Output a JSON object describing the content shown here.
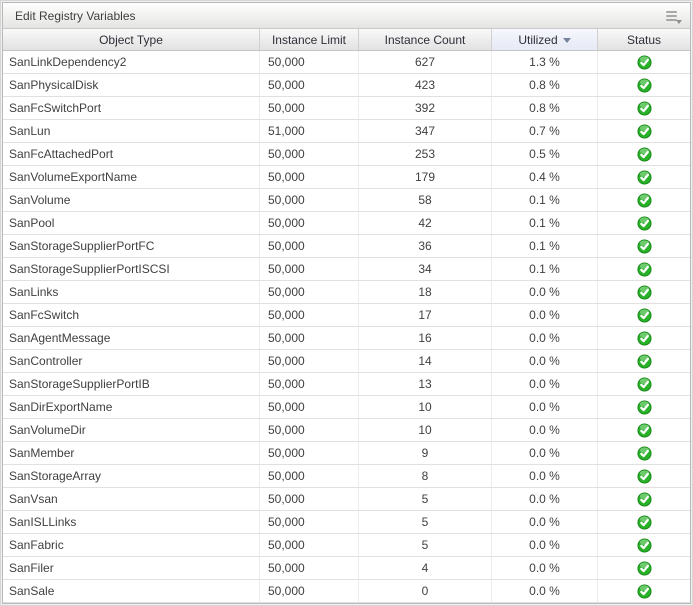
{
  "panel": {
    "title": "Edit Registry Variables",
    "tool_icon": "grid-menu-icon"
  },
  "table": {
    "columns": [
      {
        "id": "object_type",
        "label": "Object Type"
      },
      {
        "id": "instance_limit",
        "label": "Instance Limit"
      },
      {
        "id": "instance_count",
        "label": "Instance Count"
      },
      {
        "id": "utilized",
        "label": "Utilized"
      },
      {
        "id": "status",
        "label": "Status"
      }
    ],
    "sort": {
      "column": "Utilized",
      "direction": "desc"
    },
    "rows": [
      {
        "object_type": "SanLinkDependency2",
        "instance_limit": "50,000",
        "instance_count": "627",
        "utilized": "1.3 %",
        "status": "ok"
      },
      {
        "object_type": "SanPhysicalDisk",
        "instance_limit": "50,000",
        "instance_count": "423",
        "utilized": "0.8 %",
        "status": "ok"
      },
      {
        "object_type": "SanFcSwitchPort",
        "instance_limit": "50,000",
        "instance_count": "392",
        "utilized": "0.8 %",
        "status": "ok"
      },
      {
        "object_type": "SanLun",
        "instance_limit": "51,000",
        "instance_count": "347",
        "utilized": "0.7 %",
        "status": "ok"
      },
      {
        "object_type": "SanFcAttachedPort",
        "instance_limit": "50,000",
        "instance_count": "253",
        "utilized": "0.5 %",
        "status": "ok"
      },
      {
        "object_type": "SanVolumeExportName",
        "instance_limit": "50,000",
        "instance_count": "179",
        "utilized": "0.4 %",
        "status": "ok"
      },
      {
        "object_type": "SanVolume",
        "instance_limit": "50,000",
        "instance_count": "58",
        "utilized": "0.1 %",
        "status": "ok"
      },
      {
        "object_type": "SanPool",
        "instance_limit": "50,000",
        "instance_count": "42",
        "utilized": "0.1 %",
        "status": "ok"
      },
      {
        "object_type": "SanStorageSupplierPortFC",
        "instance_limit": "50,000",
        "instance_count": "36",
        "utilized": "0.1 %",
        "status": "ok"
      },
      {
        "object_type": "SanStorageSupplierPortISCSI",
        "instance_limit": "50,000",
        "instance_count": "34",
        "utilized": "0.1 %",
        "status": "ok"
      },
      {
        "object_type": "SanLinks",
        "instance_limit": "50,000",
        "instance_count": "18",
        "utilized": "0.0 %",
        "status": "ok"
      },
      {
        "object_type": "SanFcSwitch",
        "instance_limit": "50,000",
        "instance_count": "17",
        "utilized": "0.0 %",
        "status": "ok"
      },
      {
        "object_type": "SanAgentMessage",
        "instance_limit": "50,000",
        "instance_count": "16",
        "utilized": "0.0 %",
        "status": "ok"
      },
      {
        "object_type": "SanController",
        "instance_limit": "50,000",
        "instance_count": "14",
        "utilized": "0.0 %",
        "status": "ok"
      },
      {
        "object_type": "SanStorageSupplierPortIB",
        "instance_limit": "50,000",
        "instance_count": "13",
        "utilized": "0.0 %",
        "status": "ok"
      },
      {
        "object_type": "SanDirExportName",
        "instance_limit": "50,000",
        "instance_count": "10",
        "utilized": "0.0 %",
        "status": "ok"
      },
      {
        "object_type": "SanVolumeDir",
        "instance_limit": "50,000",
        "instance_count": "10",
        "utilized": "0.0 %",
        "status": "ok"
      },
      {
        "object_type": "SanMember",
        "instance_limit": "50,000",
        "instance_count": "9",
        "utilized": "0.0 %",
        "status": "ok"
      },
      {
        "object_type": "SanStorageArray",
        "instance_limit": "50,000",
        "instance_count": "8",
        "utilized": "0.0 %",
        "status": "ok"
      },
      {
        "object_type": "SanVsan",
        "instance_limit": "50,000",
        "instance_count": "5",
        "utilized": "0.0 %",
        "status": "ok"
      },
      {
        "object_type": "SanISLLinks",
        "instance_limit": "50,000",
        "instance_count": "5",
        "utilized": "0.0 %",
        "status": "ok"
      },
      {
        "object_type": "SanFabric",
        "instance_limit": "50,000",
        "instance_count": "5",
        "utilized": "0.0 %",
        "status": "ok"
      },
      {
        "object_type": "SanFiler",
        "instance_limit": "50,000",
        "instance_count": "4",
        "utilized": "0.0 %",
        "status": "ok"
      },
      {
        "object_type": "SanSale",
        "instance_limit": "50,000",
        "instance_count": "0",
        "utilized": "0.0 %",
        "status": "ok"
      }
    ]
  },
  "colors": {
    "status_ok_green": "#29b129",
    "status_ok_ring": "#148914",
    "sorted_header_bg": "#eef0f9",
    "header_text": "#2f2f38",
    "row_text": "#404040"
  }
}
